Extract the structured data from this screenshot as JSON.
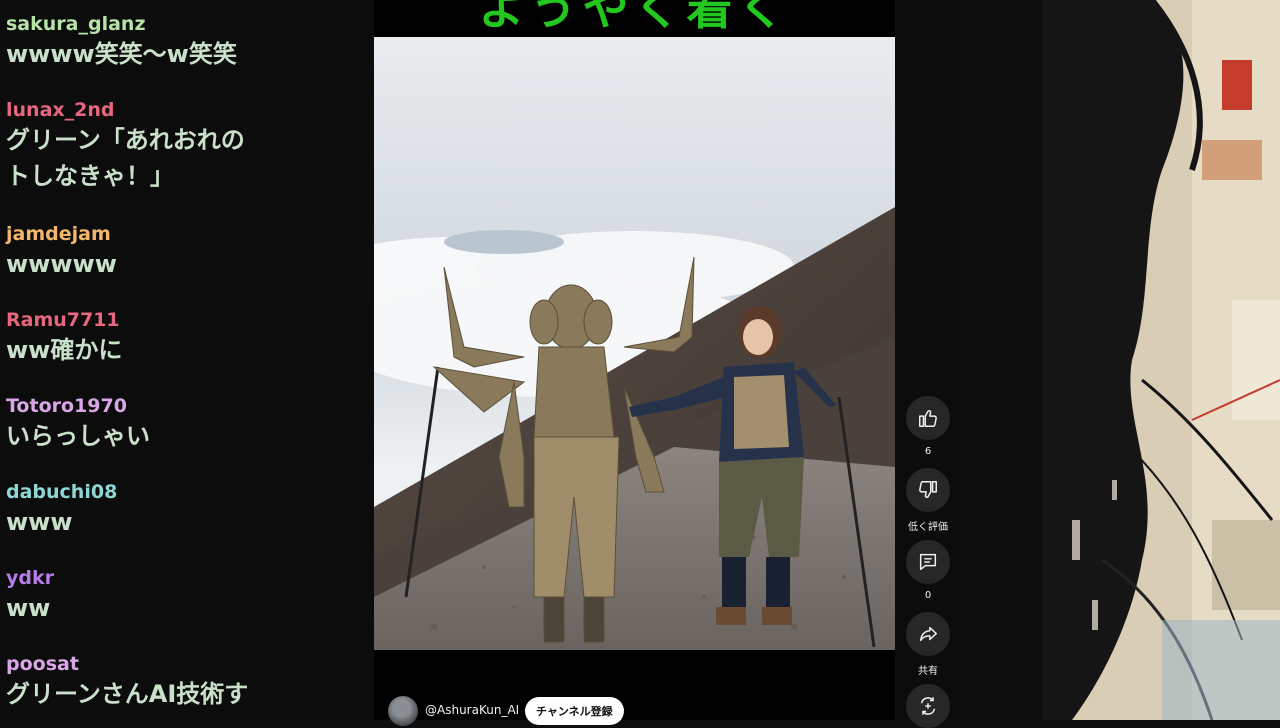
{
  "chat": {
    "messages": [
      {
        "user": "sakura_glanz",
        "user_color": "#b6e3a6",
        "lines": [
          "wwww笑笑～w笑笑"
        ]
      },
      {
        "user": "lunax_2nd",
        "user_color": "#e8677f",
        "lines": [
          "グリーン「あれおれの",
          "トしなきゃ！」"
        ]
      },
      {
        "user": "jamdejam",
        "user_color": "#f3b76a",
        "lines": [
          "wwwww"
        ]
      },
      {
        "user": "Ramu7711",
        "user_color": "#e8677f",
        "lines": [
          "ww確かに"
        ]
      },
      {
        "user": "Totoro1970",
        "user_color": "#d9a6e8",
        "lines": [
          "いらっしゃい"
        ]
      },
      {
        "user": "dabuchi08",
        "user_color": "#8fd6d6",
        "lines": [
          "www"
        ]
      },
      {
        "user": "ydkr",
        "user_color": "#b77be8",
        "lines": [
          "ww"
        ]
      },
      {
        "user": "poosat",
        "user_color": "#d9a6e8",
        "lines": [
          "グリーンさんAI技術す"
        ]
      }
    ]
  },
  "video": {
    "title_overlay": "ようやく着く",
    "channel_name": "@AshuraKun_AI",
    "subscribe_label": "チャンネル登録"
  },
  "actions": {
    "like_count": "6",
    "dislike_label": "低く評価",
    "comment_count": "0",
    "share_label": "共有"
  },
  "icons": {
    "like": "thumbs-up-icon",
    "dislike": "thumbs-down-icon",
    "comment": "comment-icon",
    "share": "share-icon",
    "remix": "remix-icon"
  },
  "colors": {
    "chat_text": "#c9e0c9",
    "title_green": "#22c81e",
    "subscribe_bg": "#ffffff",
    "action_bg": "#272727"
  }
}
